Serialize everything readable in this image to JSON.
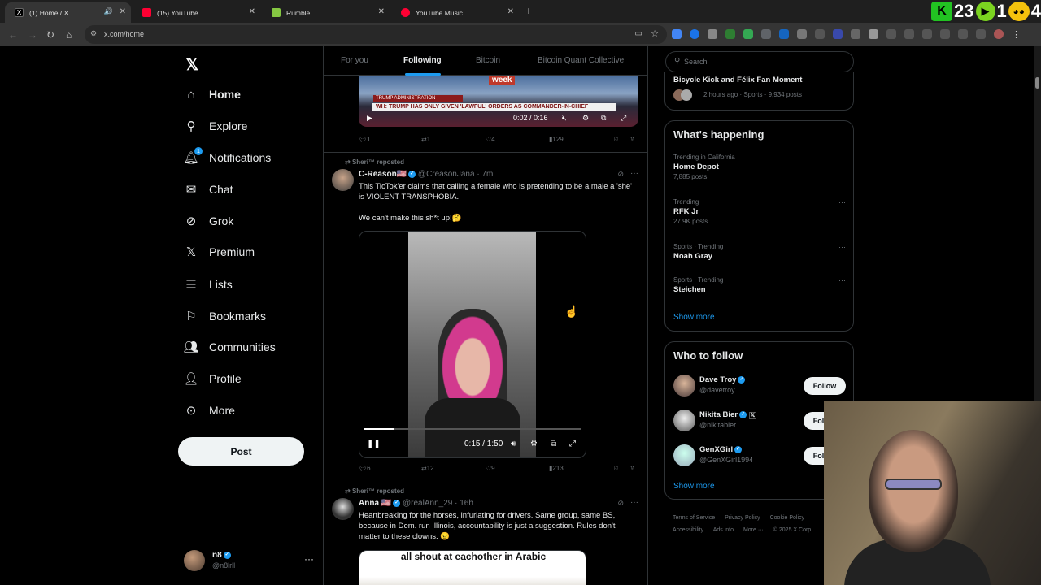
{
  "browser": {
    "tabs": [
      {
        "title": "(1) Home / X",
        "favicon_color": "#000000"
      },
      {
        "title": "(15) YouTube",
        "favicon_color": "#ff0033"
      },
      {
        "title": "Rumble",
        "favicon_color": "#85c742"
      },
      {
        "title": "YouTube Music",
        "favicon_color": "#ff0033"
      }
    ],
    "url": "x.com/home",
    "overlay_badges": {
      "k_label": "K",
      "k_count": "23",
      "play_count": "1",
      "face_count": "4"
    }
  },
  "nav": {
    "items": [
      {
        "label": "Home",
        "icon": "home-icon"
      },
      {
        "label": "Explore",
        "icon": "search-icon"
      },
      {
        "label": "Notifications",
        "icon": "bell-icon",
        "badge": "1"
      },
      {
        "label": "Chat",
        "icon": "mail-icon"
      },
      {
        "label": "Grok",
        "icon": "grok-icon"
      },
      {
        "label": "Premium",
        "icon": "x-icon"
      },
      {
        "label": "Lists",
        "icon": "list-icon"
      },
      {
        "label": "Bookmarks",
        "icon": "bookmark-icon"
      },
      {
        "label": "Communities",
        "icon": "people-icon"
      },
      {
        "label": "Profile",
        "icon": "person-icon"
      },
      {
        "label": "More",
        "icon": "more-circle-icon"
      }
    ],
    "post_label": "Post",
    "account": {
      "name": "n8",
      "handle": "@n8lrll"
    }
  },
  "feed_tabs": [
    "For you",
    "Following",
    "Bitcoin",
    "Bitcoin Quant Collective"
  ],
  "posts": [
    {
      "chyron": "WH: TRUMP HAS ONLY GIVEN 'LAWFUL' ORDERS AS COMMANDER-IN-CHIEF",
      "admin_tag": "TRUMP ADMINISTRATION",
      "logo": "week",
      "video_time": "0:02 / 0:16",
      "replies": "1",
      "reposts": "1",
      "likes": "4",
      "views": "129"
    },
    {
      "reposted_by": "Sheri™ reposted",
      "author": "C-Reason🇺🇸",
      "handle": "@CreasonJana · 7m",
      "text": "This TicTok'er claims that calling a female who is pretending to be a male a 'she' is VIOLENT TRANSPHOBIA.\n\nWe can't make this sh*t up!🤔",
      "video_time": "0:15 / 1:50",
      "progress": 0.14,
      "replies": "6",
      "reposts": "12",
      "likes": "9",
      "views": "213"
    },
    {
      "reposted_by": "Sheri™ reposted",
      "author": "Anna 🇺🇸",
      "handle": "@realAnn_29 · 16h",
      "text": "Heartbreaking for the horses, infuriating for drivers. Same group, same BS, because in Dem. run Illinois, accountability is just a suggestion. Rules don't matter to these clowns. 😠",
      "video_caption": "all shout at eachother in Arabic"
    }
  ],
  "right": {
    "search_placeholder": "Search",
    "top_trend": {
      "title": "Bicycle Kick and Félix Fan Moment",
      "meta": "2 hours ago · Sports · 9,934 posts"
    },
    "happening_title": "What's happening",
    "trends": [
      {
        "context": "Trending in California",
        "title": "Home Depot",
        "count": "7,885 posts"
      },
      {
        "context": "Trending",
        "title": "RFK Jr",
        "count": "27.9K posts"
      },
      {
        "context": "Sports · Trending",
        "title": "Noah Gray",
        "count": ""
      },
      {
        "context": "Sports · Trending",
        "title": "Steichen",
        "count": ""
      }
    ],
    "show_more": "Show more",
    "who_title": "Who to follow",
    "who": [
      {
        "name": "Dave Troy",
        "handle": "@davetroy",
        "follow": "Follow"
      },
      {
        "name": "Nikita Bier",
        "handle": "@nikitabier",
        "follow": "Follow"
      },
      {
        "name": "GenXGirl",
        "handle": "@GenXGirl1994",
        "follow": "Follow"
      }
    ],
    "footer": [
      "Terms of Service",
      "Privacy Policy",
      "Cookie Policy",
      "Accessibility",
      "Ads info",
      "More ···",
      "© 2025 X Corp."
    ]
  }
}
